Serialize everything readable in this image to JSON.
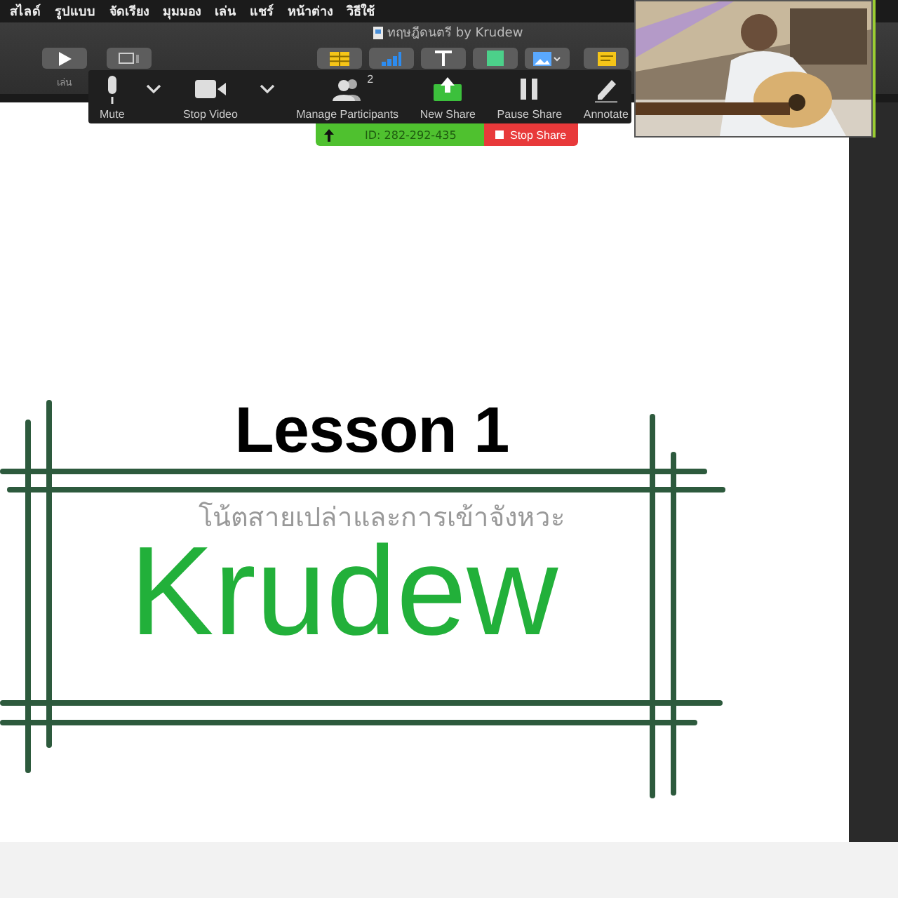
{
  "menu_bar": {
    "items": [
      "สไลด์",
      "รูปแบบ",
      "จัดเรียง",
      "มุมมอง",
      "เล่น",
      "แชร์",
      "หน้าต่าง",
      "วิธีใช้"
    ]
  },
  "document": {
    "title": "ทฤษฎีดนตรี by Krudew"
  },
  "keynote_toolbar": {
    "play_label": "เล่น",
    "tools": [
      {
        "kind": "table"
      },
      {
        "kind": "chart"
      },
      {
        "kind": "text"
      },
      {
        "kind": "shape"
      },
      {
        "kind": "media"
      },
      {
        "kind": "comment"
      }
    ]
  },
  "meeting_controls": {
    "buttons": [
      {
        "kind": "mic",
        "label": "Mute",
        "menu": true
      },
      {
        "kind": "video",
        "label": "Stop Video",
        "menu": true
      },
      {
        "kind": "participants",
        "label": "Manage Participants",
        "badge": "2",
        "menu": false
      },
      {
        "kind": "share",
        "label": "New Share",
        "menu": false
      },
      {
        "kind": "pause",
        "label": "Pause Share",
        "menu": false
      },
      {
        "kind": "annotate",
        "label": "Annotate",
        "menu": false
      }
    ]
  },
  "share_bar": {
    "meeting_id": "ID: 282-292-435",
    "stop_label": "Stop Share"
  },
  "slide": {
    "title": "Lesson 1",
    "subtitle": "โน้ตสายเปล่าและการเข้าจังหวะ",
    "name": "Krudew"
  }
}
